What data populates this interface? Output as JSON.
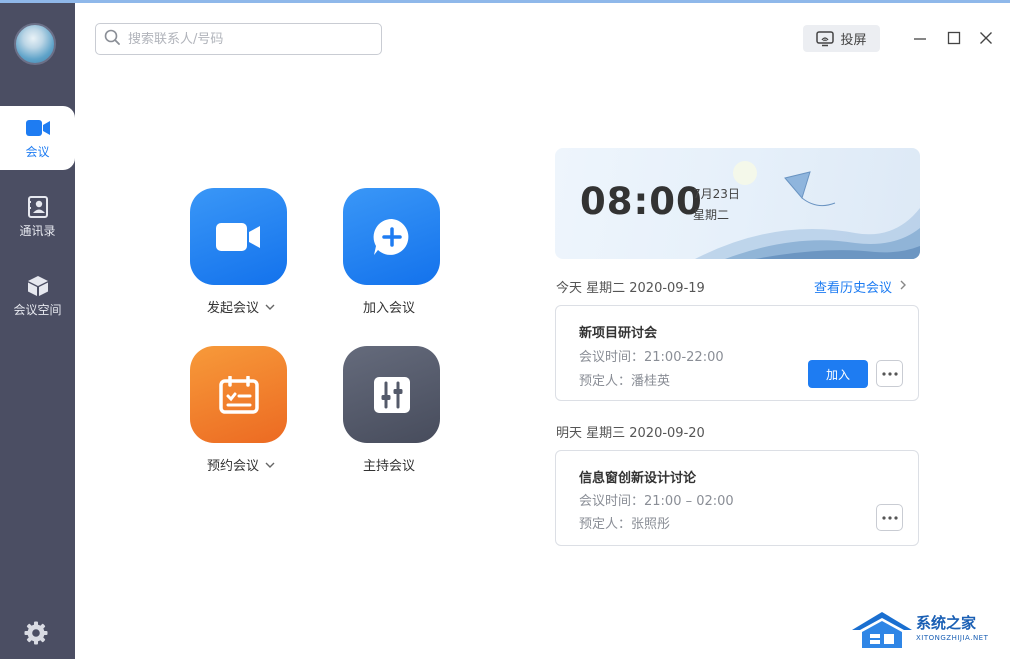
{
  "sidebar": {
    "items": [
      {
        "label": "会议",
        "icon": "video-camera-icon",
        "active": true
      },
      {
        "label": "通讯录",
        "icon": "contacts-book-icon",
        "active": false
      },
      {
        "label": "会议空间",
        "icon": "cube-icon",
        "active": false
      }
    ],
    "settings_icon": "gear-icon"
  },
  "header": {
    "search_placeholder": "搜索联系人/号码",
    "cast_label": "投屏"
  },
  "actions": [
    {
      "label": "发起会议",
      "icon": "video-camera-icon",
      "dropdown": true,
      "color": "#1e7cf2"
    },
    {
      "label": "加入会议",
      "icon": "chat-plus-icon",
      "dropdown": false,
      "color": "#1e7cf2"
    },
    {
      "label": "预约会议",
      "icon": "calendar-checklist-icon",
      "dropdown": true,
      "color": "#f07a2c"
    },
    {
      "label": "主持会议",
      "icon": "sliders-icon",
      "dropdown": false,
      "color": "#545a6a"
    }
  ],
  "banner": {
    "time": "08:00",
    "date": "7月23日",
    "weekday": "星期二"
  },
  "schedule": {
    "history_link": "查看历史会议",
    "days": [
      {
        "heading": "今天  星期二  2020-09-19",
        "meetings": [
          {
            "title": "新项目研讨会",
            "time": "会议时间：21:00-22:00",
            "organizer": "预定人：潘桂英",
            "join_label": "加入"
          }
        ]
      },
      {
        "heading": "明天  星期三  2020-09-20",
        "meetings": [
          {
            "title": "信息窗创新设计讨论",
            "time": "会议时间：21:00 – 02:00",
            "organizer": "预定人：张照彤"
          }
        ]
      }
    ]
  },
  "watermark": {
    "name": "系统之家",
    "url": "XITONGZHIJIA.NET"
  },
  "colors": {
    "accent": "#1e7cf2",
    "sidebar_bg": "#4b4e63",
    "orange": "#f07a2c",
    "gray_tile": "#545a6a"
  }
}
